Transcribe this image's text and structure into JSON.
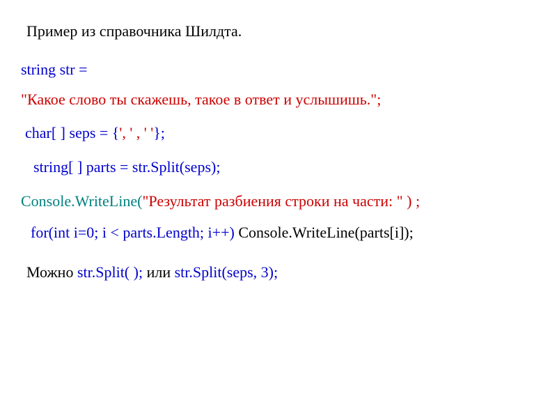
{
  "title": "Пример из справочника Шилдта.",
  "code": {
    "line2": "string str =",
    "line3": "\"Какое слово ты скажешь, такое в ответ и услышишь.\";",
    "line4_a": "char[ ] seps = {",
    "line4_b": "', ' , '   '",
    "line4_c": "};",
    "line5": "string[ ] parts = str.Split(seps);",
    "line6_a": "Console.WriteLine(",
    "line6_b": "\"Результат разбиения строки на части: \" ) ;",
    "line7_a": "for(int i=0; i < parts.Length; i++)  ",
    "line7_b": "Console.WriteLine(parts[i]);",
    "line8_a": "Можно ",
    "line8_b": "str.Split( );    ",
    "line8_c": "или    ",
    "line8_d": "str.Split(seps, 3);"
  }
}
